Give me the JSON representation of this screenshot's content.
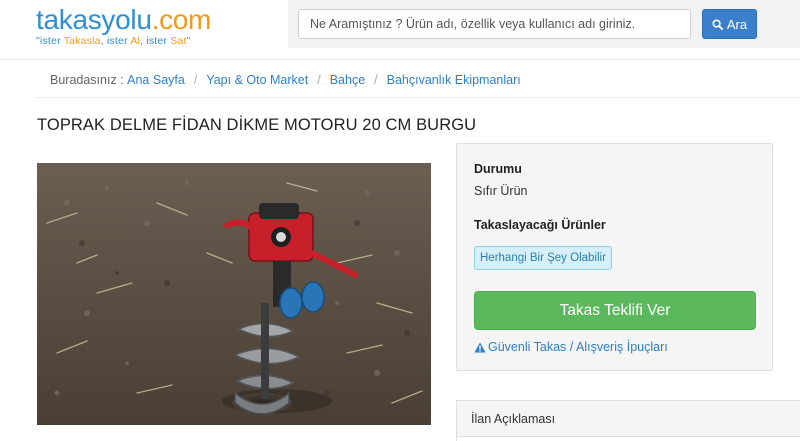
{
  "brand": {
    "name_part1": "takasyolu",
    "name_part2": ".com",
    "tagline_pre": "\"ister ",
    "tagline_takasla": "Takasla",
    "tagline_mid1": ", ister ",
    "tagline_al": "Al",
    "tagline_mid2": ", ister ",
    "tagline_sat": "Sat",
    "tagline_end": "\""
  },
  "search": {
    "placeholder": "Ne Aramıştınız ? Ürün adı, özellik veya kullanıcı adı giriniz.",
    "button_label": "Ara",
    "icon": "search-icon"
  },
  "breadcrumb": {
    "prefix": "Buradasınız :",
    "items": [
      "Ana Sayfa",
      "Yapı & Oto Market",
      "Bahçe",
      "Bahçıvanlık Ekipmanları"
    ],
    "separator": "/"
  },
  "product": {
    "title": "TOPRAK DELME FİDAN DİKME MOTORU 20 CM BURGU"
  },
  "info": {
    "condition_label": "Durumu",
    "condition_value": "Sıfır Ürün",
    "trade_label": "Takaslayacağı Ürünler",
    "trade_badge": "Herhangi Bir Şey Olabilir",
    "offer_button": "Takas Teklifi Ver",
    "tips_link": "Güvenli Takas / Alışveriş İpuçları",
    "tips_icon": "warning-icon"
  },
  "description": {
    "title": "İlan Açıklaması"
  },
  "colors": {
    "brand_blue": "#2f8fd6",
    "brand_orange": "#f39a1e",
    "search_button": "#3a7fc9",
    "offer_button": "#5cb85c",
    "link": "#2f7fc7"
  }
}
